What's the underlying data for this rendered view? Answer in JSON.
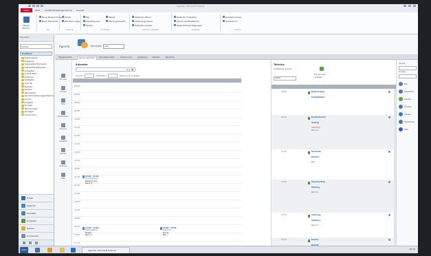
{
  "window": {
    "title": "Agenda - Microsoft Outlook"
  },
  "quick_access": [
    "save-icon",
    "undo-icon",
    "redo-icon",
    "send-receive-icon"
  ],
  "ribbon_tabs": [
    {
      "label": "Datei",
      "active": true
    },
    {
      "label": "Start"
    },
    {
      "label": "Senden/Empfangen"
    },
    {
      "label": "Ordner"
    },
    {
      "label": "Ansicht"
    }
  ],
  "ribbon_groups": [
    {
      "name": "Neu",
      "items": [
        "Neuer Termin",
        "Neue Besprechung",
        "Neue Elemente"
      ]
    },
    {
      "name": "Gehe zu",
      "items": [
        "Heute",
        "Nächste 7 Tage"
      ]
    },
    {
      "name": "Anordnen",
      "items": [
        "Tag",
        "Arbeitswoche",
        "Woche",
        "Monat",
        "Planungsansicht"
      ]
    },
    {
      "name": "Kalender verwalten",
      "items": [
        "Kalender öffnen",
        "Kalendergruppen",
        "Kalender senden"
      ]
    },
    {
      "name": "Freigeben",
      "items": [
        "Kalender freigeben",
        "Online veröffentlichen",
        "Kalenderberechtigungen"
      ]
    },
    {
      "name": "Suchen",
      "items": [
        "Kontakt suchen",
        "Adressbuch"
      ]
    }
  ],
  "nav": {
    "header": [
      "Favoriten",
      "Posteingang",
      "Gesendete Elemente"
    ],
    "search_placeholder": "Suchen",
    "account": "Postfach",
    "folders": [
      "Posteingang",
      "Entwürfe",
      "Gesendete Elemente",
      "Gelöschte Elemente",
      "Aufgaben",
      "Junk-E-Mail",
      "Kalender",
      "Kontakte",
      "Journal",
      "Notizen",
      "Outbox",
      "RSS-Feeds",
      "Synchronisierungsprobleme",
      "Archiv",
      "Projekte",
      "Kunden",
      "Rechnungen",
      "Vorlagen",
      "Suchordner"
    ],
    "buttons": [
      {
        "label": "E-Mail",
        "color": "#2f6db5"
      },
      {
        "label": "Kalender",
        "color": "#3c8fd3"
      },
      {
        "label": "Kontakte",
        "color": "#4a7fb8"
      },
      {
        "label": "Aufgaben",
        "color": "#5a9a3a"
      },
      {
        "label": "Notizen",
        "color": "#e2b02e"
      },
      {
        "label": "Ordnerliste",
        "color": "#7b8ea8"
      }
    ]
  },
  "main": {
    "app_name": "Agenda",
    "user_label": "Benutzer:",
    "user_value": "Alle",
    "tabs": [
      {
        "label": "Tagesansicht"
      },
      {
        "label": "Wochenansicht",
        "active": true
      },
      {
        "label": "Monatsansicht"
      },
      {
        "label": "Ressourcen"
      },
      {
        "label": "Aufgaben"
      },
      {
        "label": "Notizen"
      },
      {
        "label": "Berichte"
      }
    ],
    "tools": [
      "Drucken",
      "Suchen",
      "Filter",
      "Aktualisieren",
      "Kalender",
      "Kontakte",
      "Senden",
      "Optionen",
      "Hilfe"
    ],
    "calendar": {
      "header": "Kalender",
      "date_value": "",
      "option1": "Ansicht",
      "option2": "Zeitraster",
      "option3": "Ressourcen anzeigen",
      "hours": [
        "08:00",
        "08:30",
        "09:00",
        "09:30",
        "10:00",
        "10:30",
        "11:00",
        "11:30",
        "12:00",
        "12:30",
        "13:00",
        "13:30",
        "14:00",
        "14:30",
        "15:00",
        "15:30",
        "16:00",
        "16:30",
        "17:00",
        "17:30"
      ],
      "appts": [
        {
          "title": "10:00 - 11:00",
          "line1": "Kundentermin",
          "line2": "Besprechung",
          "line3": "Raum 3"
        },
        {
          "title": "14:00 - 15:00",
          "line1": "Teammeeting",
          "line2": "Projekt",
          "line3": "Raum 1"
        },
        {
          "title": "14:00 - 15:00",
          "line1": "Telefonat",
          "line2": "Kunde",
          "line3": "Büro"
        }
      ]
    },
    "agenda": {
      "header": "Termine",
      "subtext": "Anstehende Termine",
      "select_value": "Heute",
      "right_label1": "Erinnerungen",
      "right_label2": "anzeigen",
      "rows": [
        {
          "time": "09:00",
          "label": "Besprechung",
          "sub": "Projektstatus",
          "red": "",
          "grey": ""
        },
        {
          "time": "10:00",
          "label": "Kundentermin",
          "sub": "Vertrag",
          "red": "Überfällig",
          "grey": "Raum 3"
        },
        {
          "time": "11:00",
          "label": "Telefonat",
          "sub": "Rückruf",
          "red": "",
          "grey": "Büro"
        },
        {
          "time": "13:00",
          "label": "Teammeeting",
          "sub": "Planung",
          "red": "",
          "grey": "Raum 1"
        },
        {
          "time": "15:00",
          "label": "Schulung",
          "sub": "Software",
          "red": "",
          "grey": "Raum 2"
        },
        {
          "time": "16:00",
          "label": "Review",
          "sub": "Bericht",
          "red": "",
          "grey": ""
        }
      ]
    },
    "right": {
      "label1": "Ansicht",
      "label2": "Gruppe",
      "actions": [
        {
          "label": "Neu",
          "color": "#6c7a8c"
        },
        {
          "label": "Bearbeiten",
          "color": "#3f78c4"
        },
        {
          "label": "Löschen",
          "color": "#59a33b"
        },
        {
          "label": "Drucken",
          "color": "#3f78c4"
        },
        {
          "label": "Senden",
          "color": "#3f78c4"
        },
        {
          "label": "Exportieren",
          "color": "#3f78c4"
        },
        {
          "label": "Hilfe",
          "color": "#2b5ea8"
        }
      ]
    }
  },
  "taskbar": {
    "start": "Start",
    "task": "Agenda - Microsoft Outlook",
    "clock": "10:15"
  }
}
